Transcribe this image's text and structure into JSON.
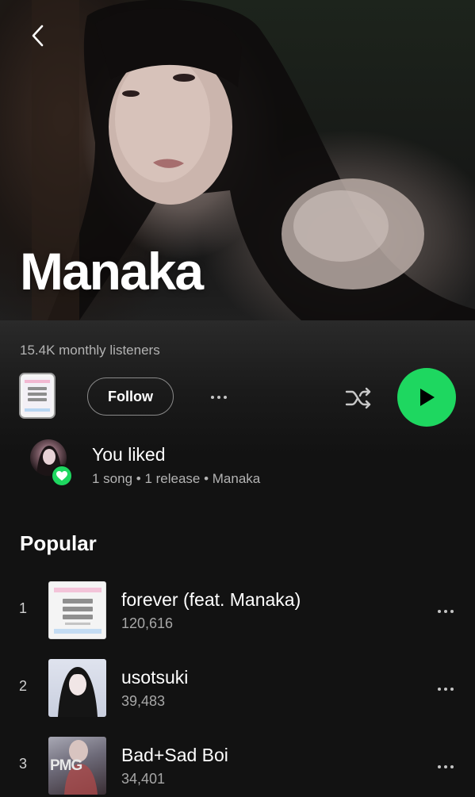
{
  "artist": {
    "name": "Manaka",
    "monthly_listeners": "15.4K monthly listeners"
  },
  "actions": {
    "follow_label": "Follow"
  },
  "liked": {
    "title": "You liked",
    "subtitle": "1 song • 1 release • Manaka"
  },
  "popular": {
    "title": "Popular",
    "tracks": [
      {
        "number": "1",
        "title": "forever (feat. Manaka)",
        "plays": "120,616"
      },
      {
        "number": "2",
        "title": "usotsuki",
        "plays": "39,483"
      },
      {
        "number": "3",
        "title": "Bad+Sad Boi",
        "plays": "34,401",
        "art_text": "PMG"
      }
    ]
  },
  "colors": {
    "accent": "#1ed760",
    "background": "#121212",
    "secondary_text": "#b3b3b3"
  },
  "icons": [
    "back-chevron-icon",
    "shuffle-icon",
    "play-icon",
    "heart-icon",
    "more-dots-icon"
  ]
}
